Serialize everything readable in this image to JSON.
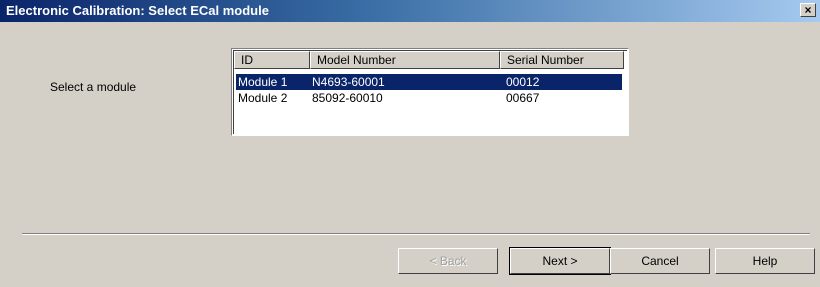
{
  "window": {
    "title": "Electronic Calibration: Select ECal module",
    "close_glyph": "×"
  },
  "label": "Select a module",
  "table": {
    "headers": [
      "ID",
      "Model Number",
      "Serial Number"
    ],
    "rows": [
      {
        "id": "Module 1",
        "model": "N4693-60001",
        "serial": "00012",
        "selected": true
      },
      {
        "id": "Module 2",
        "model": "85092-60010",
        "serial": "00667",
        "selected": false
      }
    ]
  },
  "buttons": {
    "back": "< Back",
    "next": "Next >",
    "cancel": "Cancel",
    "help": "Help"
  }
}
